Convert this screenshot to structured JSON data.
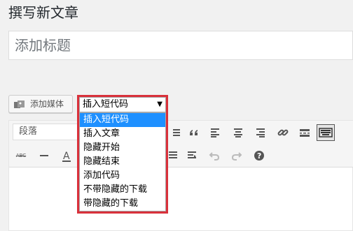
{
  "page": {
    "title": "撰写新文章"
  },
  "title_input": {
    "placeholder": "添加标题"
  },
  "media_button": {
    "label": "添加媒体",
    "icon": "media-icon"
  },
  "shortcode_select": {
    "selected": "插入短代码",
    "options": [
      "插入短代码",
      "插入文章",
      "隐藏开始",
      "隐藏结束",
      "添加代码",
      "不带隐藏的下载",
      "带隐藏的下载"
    ]
  },
  "format_select": {
    "value": "段落"
  },
  "colors": {
    "highlight": "#d9313b",
    "selected_option": "#1e90ff"
  }
}
